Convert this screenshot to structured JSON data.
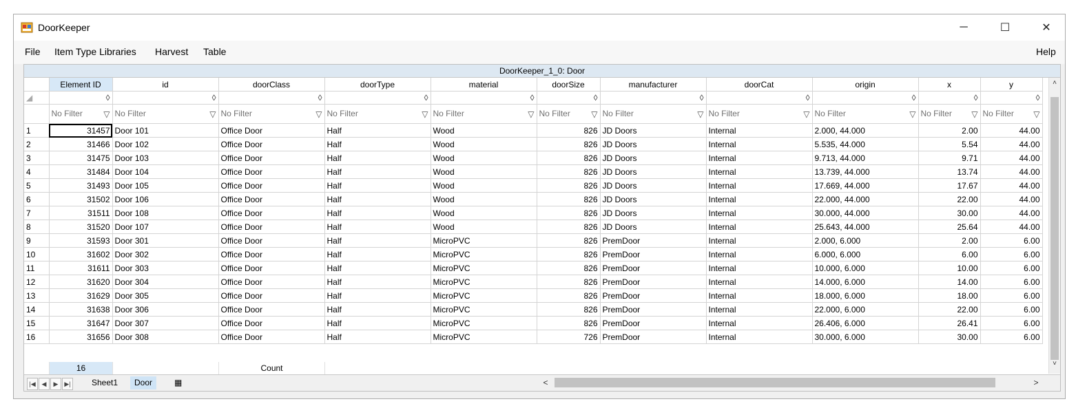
{
  "window": {
    "title": "DoorKeeper",
    "minimize": "─",
    "maximize": "☐",
    "close": "✕"
  },
  "menu": [
    "File",
    "Item Type Libraries",
    "Harvest",
    "Table"
  ],
  "help": "Help",
  "sheet_title": "DoorKeeper_1_0: Door",
  "columns": [
    "Element ID",
    "id",
    "doorClass",
    "doorType",
    "material",
    "doorSize",
    "manufacturer",
    "doorCat",
    "origin",
    "x",
    "y"
  ],
  "sort_glyph": "◊",
  "filter_text": "No Filter",
  "filter_icon": "funnel-icon",
  "rows": [
    [
      "1",
      "31457",
      "Door 101",
      "Office Door",
      "Half",
      "Wood",
      "826",
      "JD Doors",
      "Internal",
      "2.000, 44.000",
      "2.00",
      "44.00"
    ],
    [
      "2",
      "31466",
      "Door 102",
      "Office Door",
      "Half",
      "Wood",
      "826",
      "JD Doors",
      "Internal",
      "5.535, 44.000",
      "5.54",
      "44.00"
    ],
    [
      "3",
      "31475",
      "Door 103",
      "Office Door",
      "Half",
      "Wood",
      "826",
      "JD Doors",
      "Internal",
      "9.713, 44.000",
      "9.71",
      "44.00"
    ],
    [
      "4",
      "31484",
      "Door 104",
      "Office Door",
      "Half",
      "Wood",
      "826",
      "JD Doors",
      "Internal",
      "13.739, 44.000",
      "13.74",
      "44.00"
    ],
    [
      "5",
      "31493",
      "Door 105",
      "Office Door",
      "Half",
      "Wood",
      "826",
      "JD Doors",
      "Internal",
      "17.669, 44.000",
      "17.67",
      "44.00"
    ],
    [
      "6",
      "31502",
      "Door 106",
      "Office Door",
      "Half",
      "Wood",
      "826",
      "JD Doors",
      "Internal",
      "22.000, 44.000",
      "22.00",
      "44.00"
    ],
    [
      "7",
      "31511",
      "Door 108",
      "Office Door",
      "Half",
      "Wood",
      "826",
      "JD Doors",
      "Internal",
      "30.000, 44.000",
      "30.00",
      "44.00"
    ],
    [
      "8",
      "31520",
      "Door 107",
      "Office Door",
      "Half",
      "Wood",
      "826",
      "JD Doors",
      "Internal",
      "25.643, 44.000",
      "25.64",
      "44.00"
    ],
    [
      "9",
      "31593",
      "Door 301",
      "Office Door",
      "Half",
      "MicroPVC",
      "826",
      "PremDoor",
      "Internal",
      "2.000, 6.000",
      "2.00",
      "6.00"
    ],
    [
      "10",
      "31602",
      "Door 302",
      "Office Door",
      "Half",
      "MicroPVC",
      "826",
      "PremDoor",
      "Internal",
      "6.000, 6.000",
      "6.00",
      "6.00"
    ],
    [
      "11",
      "31611",
      "Door 303",
      "Office Door",
      "Half",
      "MicroPVC",
      "826",
      "PremDoor",
      "Internal",
      "10.000, 6.000",
      "10.00",
      "6.00"
    ],
    [
      "12",
      "31620",
      "Door 304",
      "Office Door",
      "Half",
      "MicroPVC",
      "826",
      "PremDoor",
      "Internal",
      "14.000, 6.000",
      "14.00",
      "6.00"
    ],
    [
      "13",
      "31629",
      "Door 305",
      "Office Door",
      "Half",
      "MicroPVC",
      "826",
      "PremDoor",
      "Internal",
      "18.000, 6.000",
      "18.00",
      "6.00"
    ],
    [
      "14",
      "31638",
      "Door 306",
      "Office Door",
      "Half",
      "MicroPVC",
      "826",
      "PremDoor",
      "Internal",
      "22.000, 6.000",
      "22.00",
      "6.00"
    ],
    [
      "15",
      "31647",
      "Door 307",
      "Office Door",
      "Half",
      "MicroPVC",
      "826",
      "PremDoor",
      "Internal",
      "26.406, 6.000",
      "26.41",
      "6.00"
    ],
    [
      "16",
      "31656",
      "Door 308",
      "Office Door",
      "Half",
      "MicroPVC",
      "726",
      "PremDoor",
      "Internal",
      "30.000, 6.000",
      "30.00",
      "6.00"
    ]
  ],
  "footer": {
    "count_value": "16",
    "count_label": "Count"
  },
  "tabs": [
    "Sheet1",
    "Door"
  ],
  "active_tab": "Door",
  "colors": {
    "header_selected": "#d7e8f7",
    "title_band": "#dde8f2",
    "active_tab": "#cfe4f6"
  }
}
